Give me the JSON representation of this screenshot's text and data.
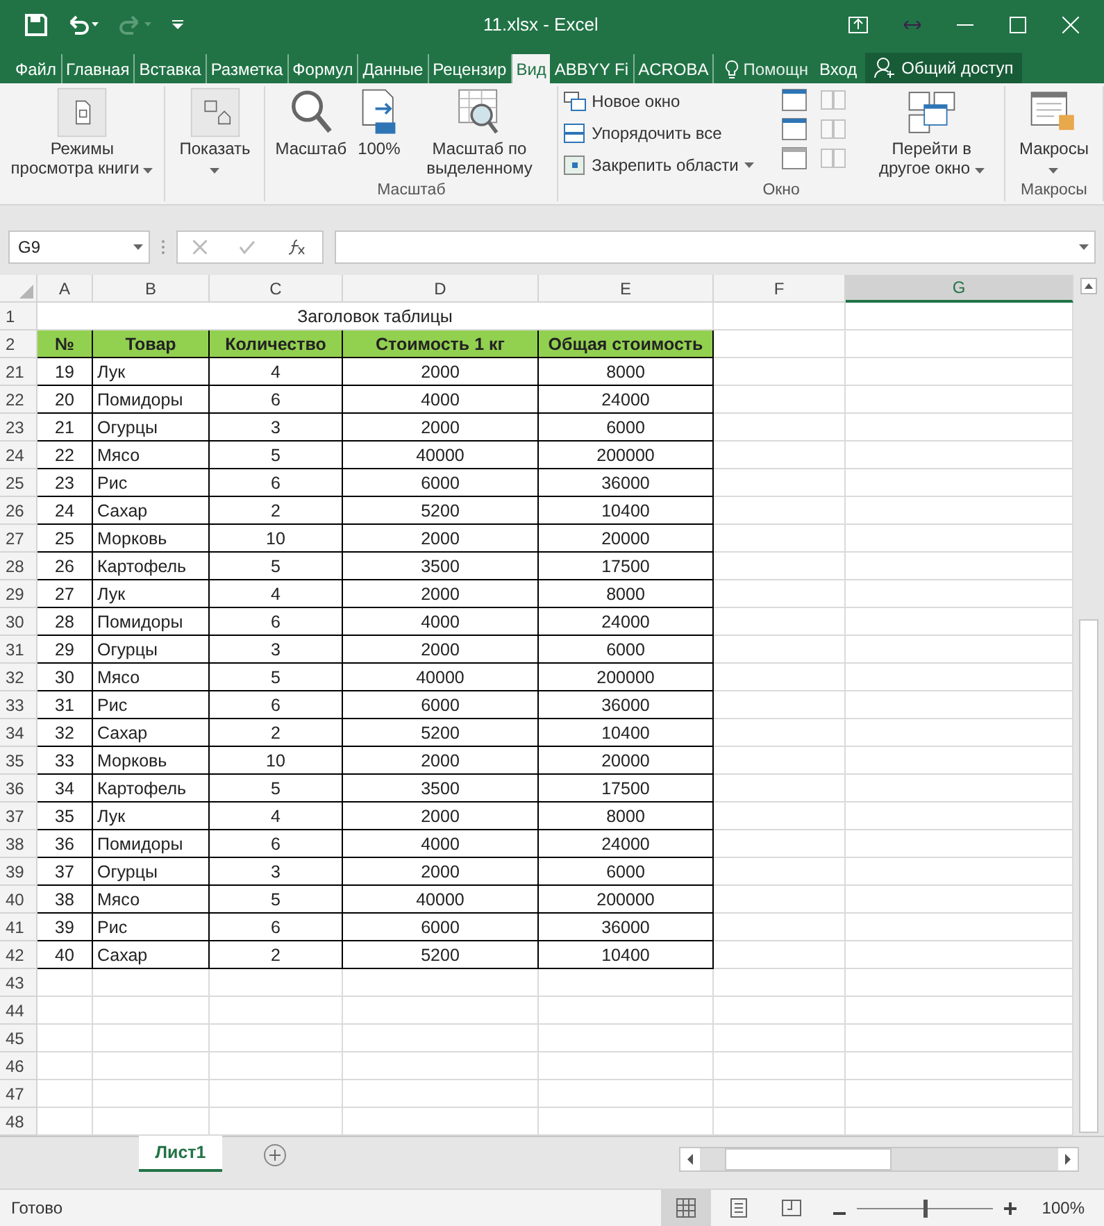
{
  "window": {
    "title": "11.xlsx - Excel"
  },
  "ribbon_tabs": [
    {
      "label": "Файл",
      "selected": false
    },
    {
      "label": "Главная",
      "selected": false
    },
    {
      "label": "Вставка",
      "selected": false
    },
    {
      "label": "Разметка",
      "selected": false
    },
    {
      "label": "Формул",
      "selected": false
    },
    {
      "label": "Данные",
      "selected": false
    },
    {
      "label": "Рецензир",
      "selected": false
    },
    {
      "label": "Вид",
      "selected": true
    },
    {
      "label": "ABBYY Fi",
      "selected": false
    },
    {
      "label": "ACROBA",
      "selected": false
    }
  ],
  "tell_me": "Помощн",
  "sign_in": "Вход",
  "share": "Общий доступ",
  "ribbon_groups": [
    {
      "buttons": [
        {
          "kind": "views",
          "label": "Режимы просмотра книги",
          "dropdown": true
        }
      ]
    },
    {
      "buttons": [
        {
          "kind": "show",
          "label": "Показать",
          "dropdown": true
        }
      ]
    },
    {
      "label": "Масштаб",
      "buttons": [
        {
          "kind": "zoom",
          "label": "Масштаб",
          "dropdown": false
        },
        {
          "kind": "hundred",
          "label": "100%",
          "dropdown": false
        },
        {
          "kind": "zoomsel",
          "label": "Масштаб по выделенному",
          "dropdown": false
        }
      ]
    },
    {
      "label": "Окно",
      "small": [
        {
          "kind": "newwin",
          "label": "Новое окно",
          "dropdown": false
        },
        {
          "kind": "arrange",
          "label": "Упорядочить все",
          "dropdown": false
        },
        {
          "kind": "freeze",
          "label": "Закрепить области",
          "dropdown": true
        }
      ],
      "buttons": [
        {
          "kind": "switch",
          "label": "Перейти в другое окно",
          "dropdown": true
        }
      ]
    },
    {
      "label": "Макросы",
      "buttons": [
        {
          "kind": "macro",
          "label": "Макросы",
          "dropdown": true
        }
      ]
    }
  ],
  "name_box": "G9",
  "columns": [
    {
      "label": "A",
      "selected": false
    },
    {
      "label": "B",
      "selected": false
    },
    {
      "label": "C",
      "selected": false
    },
    {
      "label": "D",
      "selected": false
    },
    {
      "label": "E",
      "selected": false
    },
    {
      "label": "F",
      "selected": false
    },
    {
      "label": "G",
      "selected": true
    }
  ],
  "title_row": {
    "row": "1",
    "text": "Заголовок таблицы"
  },
  "header_row": {
    "row": "2",
    "cells": [
      "№",
      "Товар",
      "Количество",
      "Стоимость 1 кг",
      "Общая стоимость"
    ]
  },
  "rows": [
    {
      "row": "21",
      "cells": [
        "19",
        "Лук",
        "4",
        "2000",
        "8000"
      ]
    },
    {
      "row": "22",
      "cells": [
        "20",
        "Помидоры",
        "6",
        "4000",
        "24000"
      ]
    },
    {
      "row": "23",
      "cells": [
        "21",
        "Огурцы",
        "3",
        "2000",
        "6000"
      ]
    },
    {
      "row": "24",
      "cells": [
        "22",
        "Мясо",
        "5",
        "40000",
        "200000"
      ]
    },
    {
      "row": "25",
      "cells": [
        "23",
        "Рис",
        "6",
        "6000",
        "36000"
      ]
    },
    {
      "row": "26",
      "cells": [
        "24",
        "Сахар",
        "2",
        "5200",
        "10400"
      ]
    },
    {
      "row": "27",
      "cells": [
        "25",
        "Морковь",
        "10",
        "2000",
        "20000"
      ]
    },
    {
      "row": "28",
      "cells": [
        "26",
        "Картофель",
        "5",
        "3500",
        "17500"
      ]
    },
    {
      "row": "29",
      "cells": [
        "27",
        "Лук",
        "4",
        "2000",
        "8000"
      ]
    },
    {
      "row": "30",
      "cells": [
        "28",
        "Помидоры",
        "6",
        "4000",
        "24000"
      ]
    },
    {
      "row": "31",
      "cells": [
        "29",
        "Огурцы",
        "3",
        "2000",
        "6000"
      ]
    },
    {
      "row": "32",
      "cells": [
        "30",
        "Мясо",
        "5",
        "40000",
        "200000"
      ]
    },
    {
      "row": "33",
      "cells": [
        "31",
        "Рис",
        "6",
        "6000",
        "36000"
      ]
    },
    {
      "row": "34",
      "cells": [
        "32",
        "Сахар",
        "2",
        "5200",
        "10400"
      ]
    },
    {
      "row": "35",
      "cells": [
        "33",
        "Морковь",
        "10",
        "2000",
        "20000"
      ]
    },
    {
      "row": "36",
      "cells": [
        "34",
        "Картофель",
        "5",
        "3500",
        "17500"
      ]
    },
    {
      "row": "37",
      "cells": [
        "35",
        "Лук",
        "4",
        "2000",
        "8000"
      ]
    },
    {
      "row": "38",
      "cells": [
        "36",
        "Помидоры",
        "6",
        "4000",
        "24000"
      ]
    },
    {
      "row": "39",
      "cells": [
        "37",
        "Огурцы",
        "3",
        "2000",
        "6000"
      ]
    },
    {
      "row": "40",
      "cells": [
        "38",
        "Мясо",
        "5",
        "40000",
        "200000"
      ]
    },
    {
      "row": "41",
      "cells": [
        "39",
        "Рис",
        "6",
        "6000",
        "36000"
      ]
    },
    {
      "row": "42",
      "cells": [
        "40",
        "Сахар",
        "2",
        "5200",
        "10400"
      ]
    },
    {
      "row": "43",
      "cells": []
    },
    {
      "row": "44",
      "cells": []
    },
    {
      "row": "45",
      "cells": []
    },
    {
      "row": "46",
      "cells": []
    },
    {
      "row": "47",
      "cells": []
    },
    {
      "row": "48",
      "cells": []
    }
  ],
  "sheet_tabs": [
    {
      "label": "Лист1",
      "selected": true
    }
  ],
  "status": "Готово",
  "zoom": {
    "level": 0.5,
    "reading": "100%"
  }
}
